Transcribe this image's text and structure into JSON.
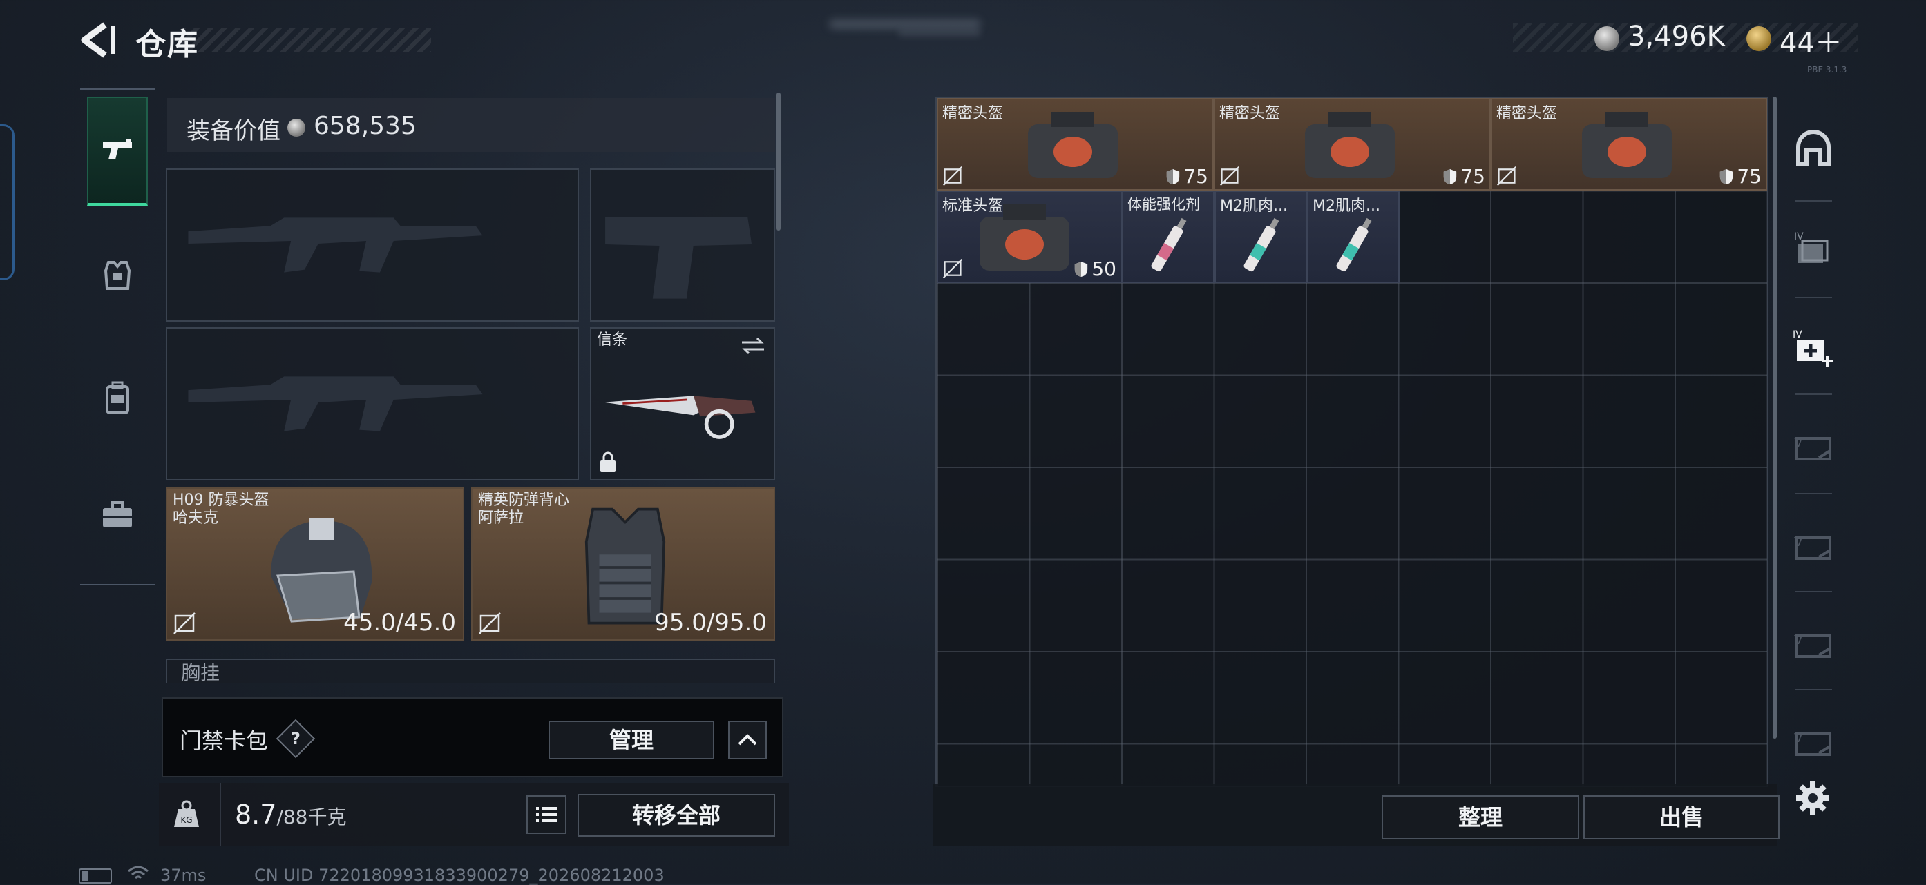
{
  "header": {
    "title": "仓库",
    "currency_primary": "3,496K",
    "currency_secondary": "44＋",
    "build_tag": "PBE 3.1.3"
  },
  "left_nav": {
    "items": [
      {
        "name": "weapons",
        "icon": "pistol-icon",
        "active": true
      },
      {
        "name": "armor",
        "icon": "vest-icon",
        "active": false
      },
      {
        "name": "backpack",
        "icon": "backpack-icon",
        "active": false
      },
      {
        "name": "case",
        "icon": "briefcase-icon",
        "active": false
      }
    ]
  },
  "loadout": {
    "value_label": "装备价值",
    "value": "658,535",
    "melee_label": "信条",
    "helmet": {
      "name": "H09 防暴头盔",
      "sub": "哈夫克",
      "durability": "45.0/45.0"
    },
    "vest": {
      "name": "精英防弹背心",
      "sub": "阿萨拉",
      "durability": "95.0/95.0"
    },
    "next_section_label": "胸挂"
  },
  "keycard": {
    "label": "门禁卡包",
    "help": "?",
    "manage": "管理"
  },
  "capacity": {
    "current": "8.7",
    "max": "/88千克",
    "weight_badge": "KG",
    "transfer_all": "转移全部"
  },
  "storage": {
    "items": [
      {
        "name": "精密头盔",
        "value": "75",
        "color": "orange"
      },
      {
        "name": "精密头盔",
        "value": "75",
        "color": "orange"
      },
      {
        "name": "精密头盔",
        "value": "75",
        "color": "orange"
      },
      {
        "name": "标准头盔",
        "value": "50",
        "color": "blue"
      },
      {
        "name": "体能强化剂",
        "value": "",
        "color": "blue"
      },
      {
        "name": "M2肌肉...",
        "value": "",
        "color": "blue"
      },
      {
        "name": "M2肌肉...",
        "value": "",
        "color": "blue"
      }
    ],
    "sort": "整理",
    "sell": "出售"
  },
  "status_bar": {
    "ping": "37ms",
    "uid": "CN UID 72201809931833900279_202608212003"
  },
  "colors": {
    "accent_green": "#3fd89e",
    "rarity_orange": "#5a4534",
    "rarity_blue": "#2d3346"
  }
}
